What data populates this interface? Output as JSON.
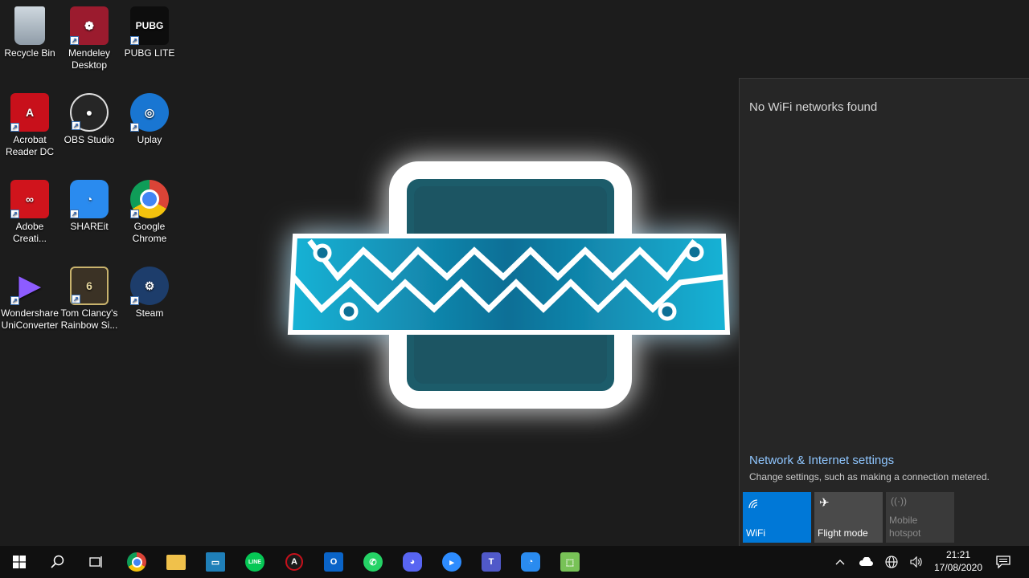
{
  "desktop": {
    "icons": [
      {
        "label": "Recycle Bin",
        "icon": "recycle-bin-icon",
        "color": "#9aa7b3"
      },
      {
        "label": "Mendeley Desktop",
        "icon": "mendeley-icon",
        "color": "#9b1b2e"
      },
      {
        "label": "PUBG LITE",
        "icon": "pubg-lite-icon",
        "color": "#0d0d0d"
      },
      {
        "label": "Acrobat Reader DC",
        "icon": "acrobat-icon",
        "color": "#c8101b"
      },
      {
        "label": "OBS Studio",
        "icon": "obs-icon",
        "color": "#262626"
      },
      {
        "label": "Uplay",
        "icon": "uplay-icon",
        "color": "#1976d2"
      },
      {
        "label": "Adobe Creati...",
        "icon": "adobe-cc-icon",
        "color": "#d0141c"
      },
      {
        "label": "SHAREit",
        "icon": "shareit-icon",
        "color": "#2a8bef"
      },
      {
        "label": "Google Chrome",
        "icon": "chrome-icon",
        "color": "#ffffff"
      },
      {
        "label": "Wondershare UniConverter",
        "icon": "uniconverter-icon",
        "color": "#6a2cf0"
      },
      {
        "label": "Tom Clancy's Rainbow Si...",
        "icon": "rainbow-six-icon",
        "color": "#3b3225"
      },
      {
        "label": "Steam",
        "icon": "steam-icon",
        "color": "#1d3d6b"
      }
    ]
  },
  "flyout": {
    "status": "No WiFi networks found",
    "settings_link": "Network & Internet settings",
    "settings_desc": "Change settings, such as making a connection metered.",
    "tiles": [
      {
        "label": "WiFi",
        "icon": "wifi-icon",
        "state": "on"
      },
      {
        "label": "Flight mode",
        "icon": "airplane-icon",
        "state": "off"
      },
      {
        "label": "Mobile hotspot",
        "icon": "hotspot-icon",
        "state": "disabled"
      }
    ],
    "accent": "#0078d7"
  },
  "taskbar": {
    "apps": [
      {
        "name": "chrome",
        "icon": "chrome-icon"
      },
      {
        "name": "file-explorer",
        "icon": "folder-icon"
      },
      {
        "name": "screen-app",
        "icon": "monitor-icon"
      },
      {
        "name": "line",
        "icon": "line-icon",
        "text": "LINE"
      },
      {
        "name": "app-a",
        "icon": "a-icon",
        "text": "A"
      },
      {
        "name": "outlook",
        "icon": "outlook-icon",
        "text": "O"
      },
      {
        "name": "whatsapp",
        "icon": "whatsapp-icon"
      },
      {
        "name": "discord",
        "icon": "discord-icon"
      },
      {
        "name": "zoom",
        "icon": "zoom-icon"
      },
      {
        "name": "teams",
        "icon": "teams-icon",
        "text": "T"
      },
      {
        "name": "shareit",
        "icon": "shareit-icon"
      },
      {
        "name": "android-app",
        "icon": "android-icon"
      }
    ],
    "clock_time": "21:21",
    "clock_date": "17/08/2020"
  }
}
